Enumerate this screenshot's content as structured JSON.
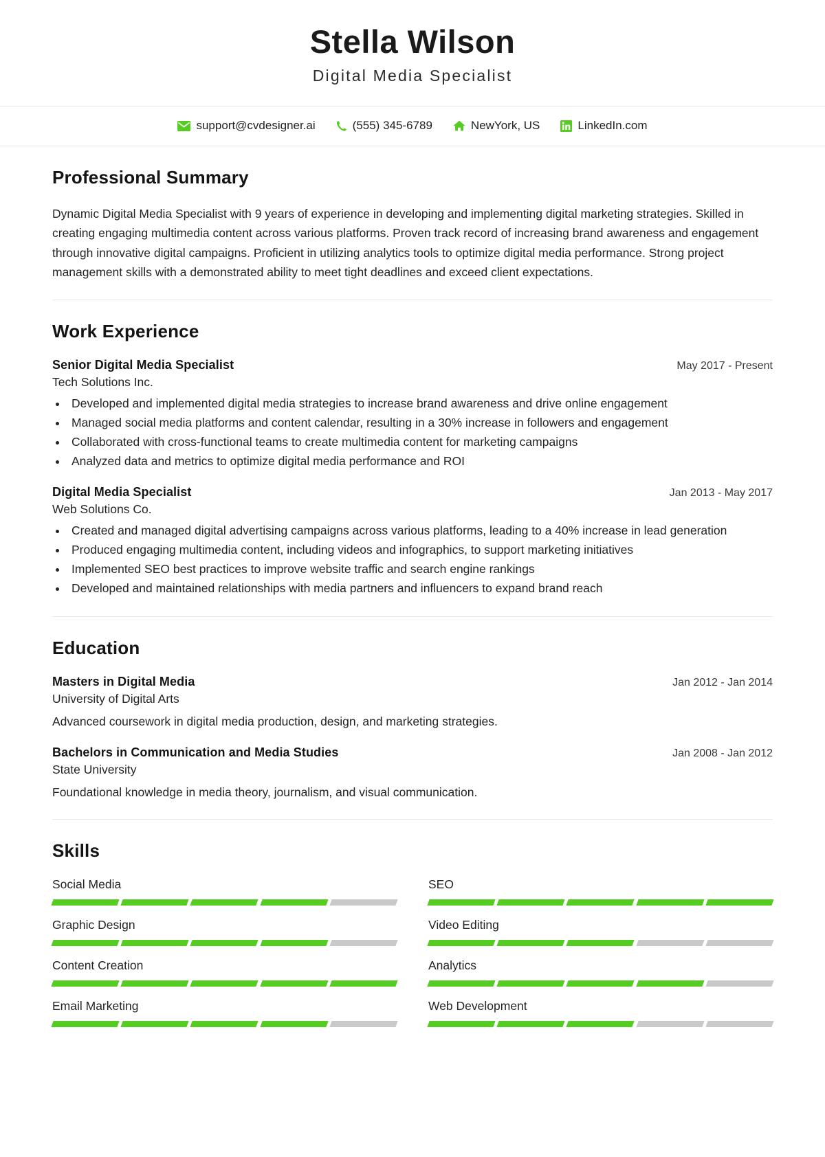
{
  "header": {
    "name": "Stella Wilson",
    "title": "Digital Media Specialist"
  },
  "contact": {
    "email": {
      "icon": "envelope-icon",
      "text": "support@cvdesigner.ai"
    },
    "phone": {
      "icon": "phone-icon",
      "text": "(555) 345-6789"
    },
    "location": {
      "icon": "home-icon",
      "text": "NewYork, US"
    },
    "linkedin": {
      "icon": "linkedin-icon",
      "text": "LinkedIn.com"
    }
  },
  "colors": {
    "accent_green": "#55cc22",
    "bar_empty": "#c9c9c9",
    "divider": "#e8e8e8"
  },
  "sections": {
    "summary": {
      "title": "Professional Summary",
      "text": "Dynamic Digital Media Specialist with 9 years of experience in developing and implementing digital marketing strategies. Skilled in creating engaging multimedia content across various platforms. Proven track record of increasing brand awareness and engagement through innovative digital campaigns. Proficient in utilizing analytics tools to optimize digital media performance. Strong project management skills with a demonstrated ability to meet tight deadlines and exceed client expectations."
    },
    "work": {
      "title": "Work Experience",
      "entries": [
        {
          "role": "Senior Digital Media Specialist",
          "date": "May 2017 - Present",
          "org": "Tech Solutions Inc.",
          "bullets": [
            "Developed and implemented digital media strategies to increase brand awareness and drive online engagement",
            "Managed social media platforms and content calendar, resulting in a 30% increase in followers and engagement",
            "Collaborated with cross-functional teams to create multimedia content for marketing campaigns",
            "Analyzed data and metrics to optimize digital media performance and ROI"
          ]
        },
        {
          "role": "Digital Media Specialist",
          "date": "Jan 2013 - May 2017",
          "org": "Web Solutions Co.",
          "bullets": [
            "Created and managed digital advertising campaigns across various platforms, leading to a 40% increase in lead generation",
            "Produced engaging multimedia content, including videos and infographics, to support marketing initiatives",
            "Implemented SEO best practices to improve website traffic and search engine rankings",
            "Developed and maintained relationships with media partners and influencers to expand brand reach"
          ]
        }
      ]
    },
    "education": {
      "title": "Education",
      "entries": [
        {
          "role": "Masters in Digital Media",
          "date": "Jan 2012 - Jan 2014",
          "org": "University of Digital Arts",
          "description": "Advanced coursework in digital media production, design, and marketing strategies."
        },
        {
          "role": "Bachelors in Communication and Media Studies",
          "date": "Jan 2008 - Jan 2012",
          "org": "State University",
          "description": "Foundational knowledge in media theory, journalism, and visual communication."
        }
      ]
    },
    "skills": {
      "title": "Skills",
      "max_level": 5,
      "items": [
        {
          "label": "Social Media",
          "level": 4
        },
        {
          "label": "SEO",
          "level": 5
        },
        {
          "label": "Graphic Design",
          "level": 4
        },
        {
          "label": "Video Editing",
          "level": 3
        },
        {
          "label": "Content Creation",
          "level": 5
        },
        {
          "label": "Analytics",
          "level": 4
        },
        {
          "label": "Email Marketing",
          "level": 4
        },
        {
          "label": "Web Development",
          "level": 3
        }
      ]
    }
  }
}
